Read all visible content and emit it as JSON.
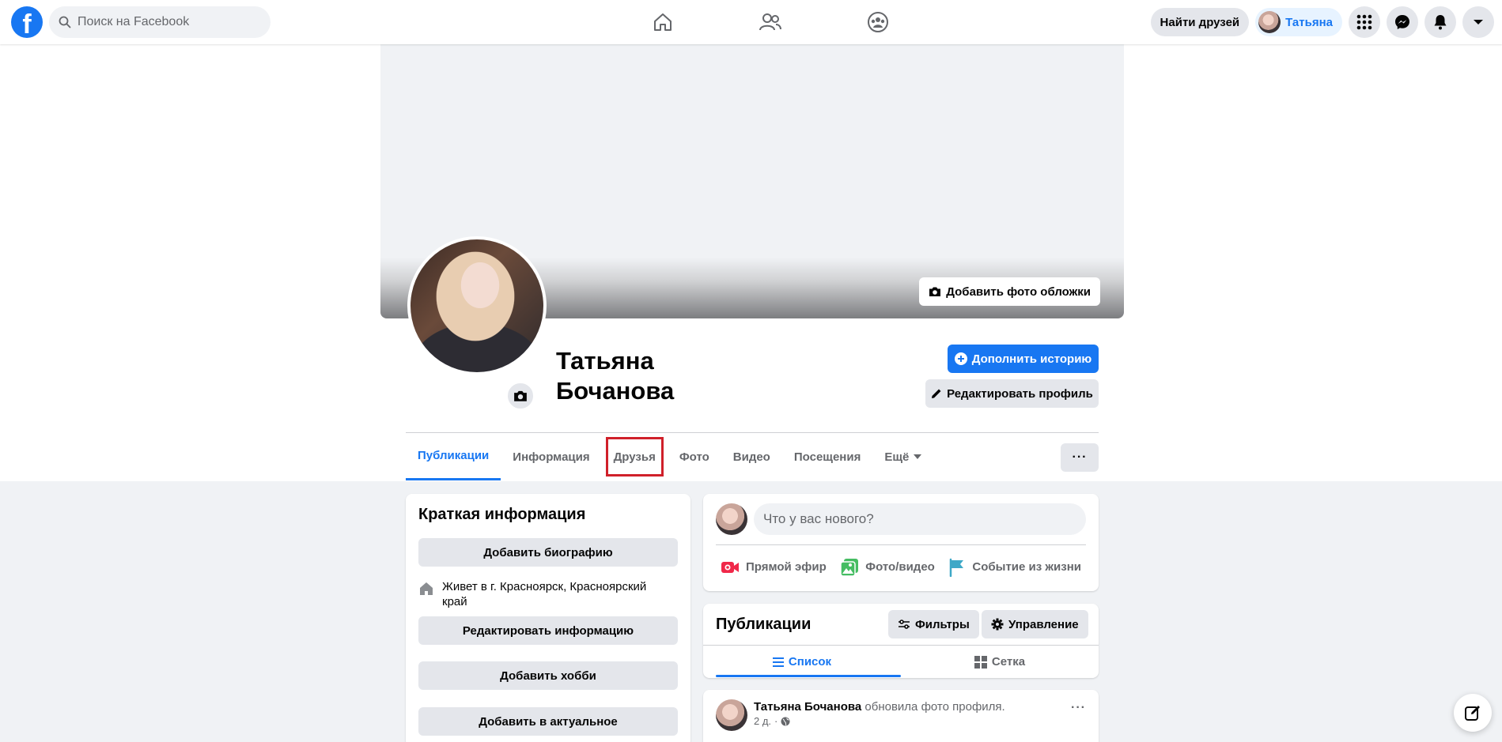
{
  "topbar": {
    "logo_letter": "f",
    "search_placeholder": "Поиск на Facebook",
    "nav_icons": [
      "home-icon",
      "friends-icon",
      "groups-icon"
    ],
    "find_friends_label": "Найти друзей",
    "user_name": "Татьяна",
    "right_icons": [
      "menu-grid-icon",
      "messenger-icon",
      "notifications-icon",
      "account-dropdown-icon"
    ]
  },
  "cover": {
    "add_cover_label": "Добавить фото обложки"
  },
  "profile": {
    "name": "Татьяна Бочанова",
    "add_story_label": "Дополнить историю",
    "edit_profile_label": "Редактировать профиль"
  },
  "tabs": [
    {
      "label": "Публикации",
      "active": true
    },
    {
      "label": "Информация"
    },
    {
      "label": "Друзья",
      "highlighted": true
    },
    {
      "label": "Фото"
    },
    {
      "label": "Видео"
    },
    {
      "label": "Посещения"
    },
    {
      "label": "Ещё"
    }
  ],
  "more_label": "···",
  "intro": {
    "title": "Краткая информация",
    "add_bio_label": "Добавить биографию",
    "lives_in": "Живет в г. Красноярск, Красноярский край",
    "edit_info_label": "Редактировать информацию",
    "add_hobby_label": "Добавить хобби",
    "add_featured_label": "Добавить в актуальное"
  },
  "composer": {
    "placeholder": "Что у вас нового?",
    "actions": [
      {
        "label": "Прямой эфир",
        "icon": "live-video-icon",
        "color": "#f02849"
      },
      {
        "label": "Фото/видео",
        "icon": "photo-video-icon",
        "color": "#45bd62"
      },
      {
        "label": "Событие из жизни",
        "icon": "life-event-flag-icon",
        "color": "#3ea8c7"
      }
    ]
  },
  "publications": {
    "title": "Публикации",
    "filters_label": "Фильтры",
    "manage_label": "Управление",
    "list_view_label": "Список",
    "grid_view_label": "Сетка"
  },
  "post": {
    "author": "Татьяна Бочанова",
    "action": " обновила фото профиля.",
    "time": "2 д.",
    "menu": "···"
  },
  "colors": {
    "accent": "#1877f2",
    "highlight_box": "#d0202a",
    "page_bg": "#f0f2f5"
  }
}
